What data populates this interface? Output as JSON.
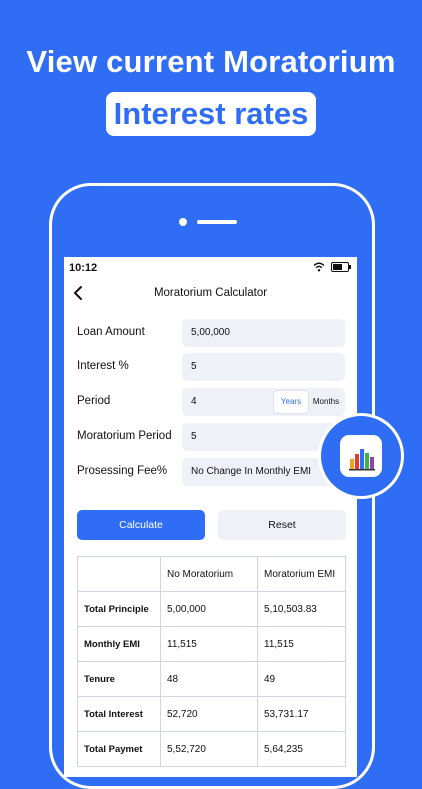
{
  "headline": "View current Moratorium",
  "highlight": "Interest rates",
  "status_bar": {
    "time": "10:12"
  },
  "navbar": {
    "back_icon": "chevron-left-icon",
    "title": "Moratorium Calculator"
  },
  "form": {
    "loan_amount": {
      "label": "Loan Amount",
      "value": "5,00,000"
    },
    "interest": {
      "label": "Interest %",
      "value": "5"
    },
    "period": {
      "label": "Period",
      "value": "4",
      "options": [
        "Years",
        "Months"
      ],
      "selected": "Years"
    },
    "moratorium_period": {
      "label": "Moratorium Period",
      "value": "5"
    },
    "processing_fee": {
      "label": "Prosessing Fee%",
      "value": "No Change In Monthly EMI"
    }
  },
  "buttons": {
    "calculate": "Calculate",
    "reset": "Reset"
  },
  "table": {
    "headers": [
      "",
      "No Moratorium",
      "Moratorium EMI"
    ],
    "rows": [
      [
        "Total Principle",
        "5,00,000",
        "5,10,503.83"
      ],
      [
        "Monthly EMI",
        "11,515",
        "11,515"
      ],
      [
        "Tenure",
        "48",
        "49"
      ],
      [
        "Total Interest",
        "52,720",
        "53,731.17"
      ],
      [
        "Total Paymet",
        "5,52,720",
        "5,64,235"
      ]
    ]
  },
  "app_icon": "bar-chart-icon",
  "colors": {
    "brand_blue": "#2f6df5",
    "field_bg": "#eef2f8",
    "white": "#ffffff"
  }
}
